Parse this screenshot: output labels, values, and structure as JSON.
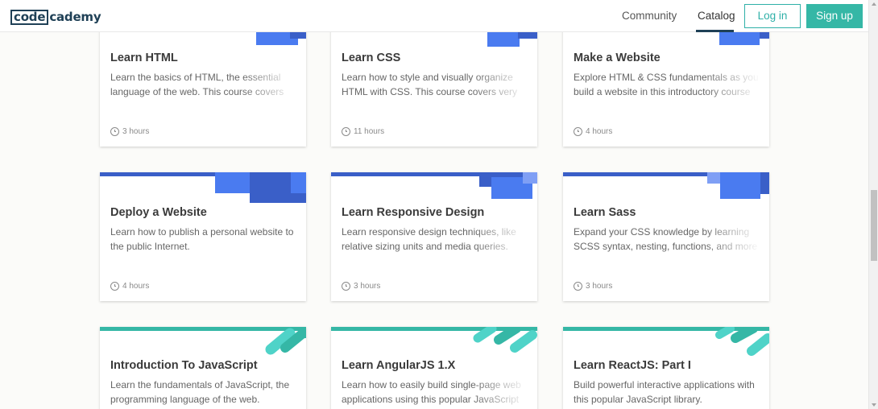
{
  "header": {
    "logo_boxed": "code",
    "logo_rest": "cademy",
    "nav": {
      "community": "Community",
      "catalog": "Catalog"
    },
    "login": "Log in",
    "signup": "Sign up"
  },
  "colors": {
    "blue": "#4a7bf0",
    "blue_dark": "#3a5fc8",
    "blue_light": "#7f9ff5",
    "teal": "#35b7a6",
    "teal_light": "#4fd3c8"
  },
  "cards": [
    {
      "title": "Learn HTML",
      "desc": "Learn the basics of HTML, the essential language of the web. This course covers",
      "duration": "3 hours"
    },
    {
      "title": "Learn CSS",
      "desc": "Learn how to style and visually organize HTML with CSS. This course covers very",
      "duration": "11 hours"
    },
    {
      "title": "Make a Website",
      "desc": "Explore HTML & CSS fundamentals as you build a website in this introductory course",
      "duration": "4 hours"
    },
    {
      "title": "Deploy a Website",
      "desc": "Learn how to publish a personal website to the public Internet.",
      "duration": "4 hours"
    },
    {
      "title": "Learn Responsive Design",
      "desc": "Learn responsive design techniques, like relative sizing units and media queries.",
      "duration": "3 hours"
    },
    {
      "title": "Learn Sass",
      "desc": "Expand your CSS knowledge by learning SCSS syntax, nesting, functions, and more",
      "duration": "3 hours"
    },
    {
      "title": "Introduction To JavaScript",
      "desc": "Learn the fundamentals of JavaScript, the programming language of the web.",
      "duration": ""
    },
    {
      "title": "Learn AngularJS 1.X",
      "desc": "Learn how to easily build single-page web applications using this popular JavaScript",
      "duration": ""
    },
    {
      "title": "Learn ReactJS: Part I",
      "desc": "Build powerful interactive applications with this popular JavaScript library.",
      "duration": ""
    }
  ]
}
